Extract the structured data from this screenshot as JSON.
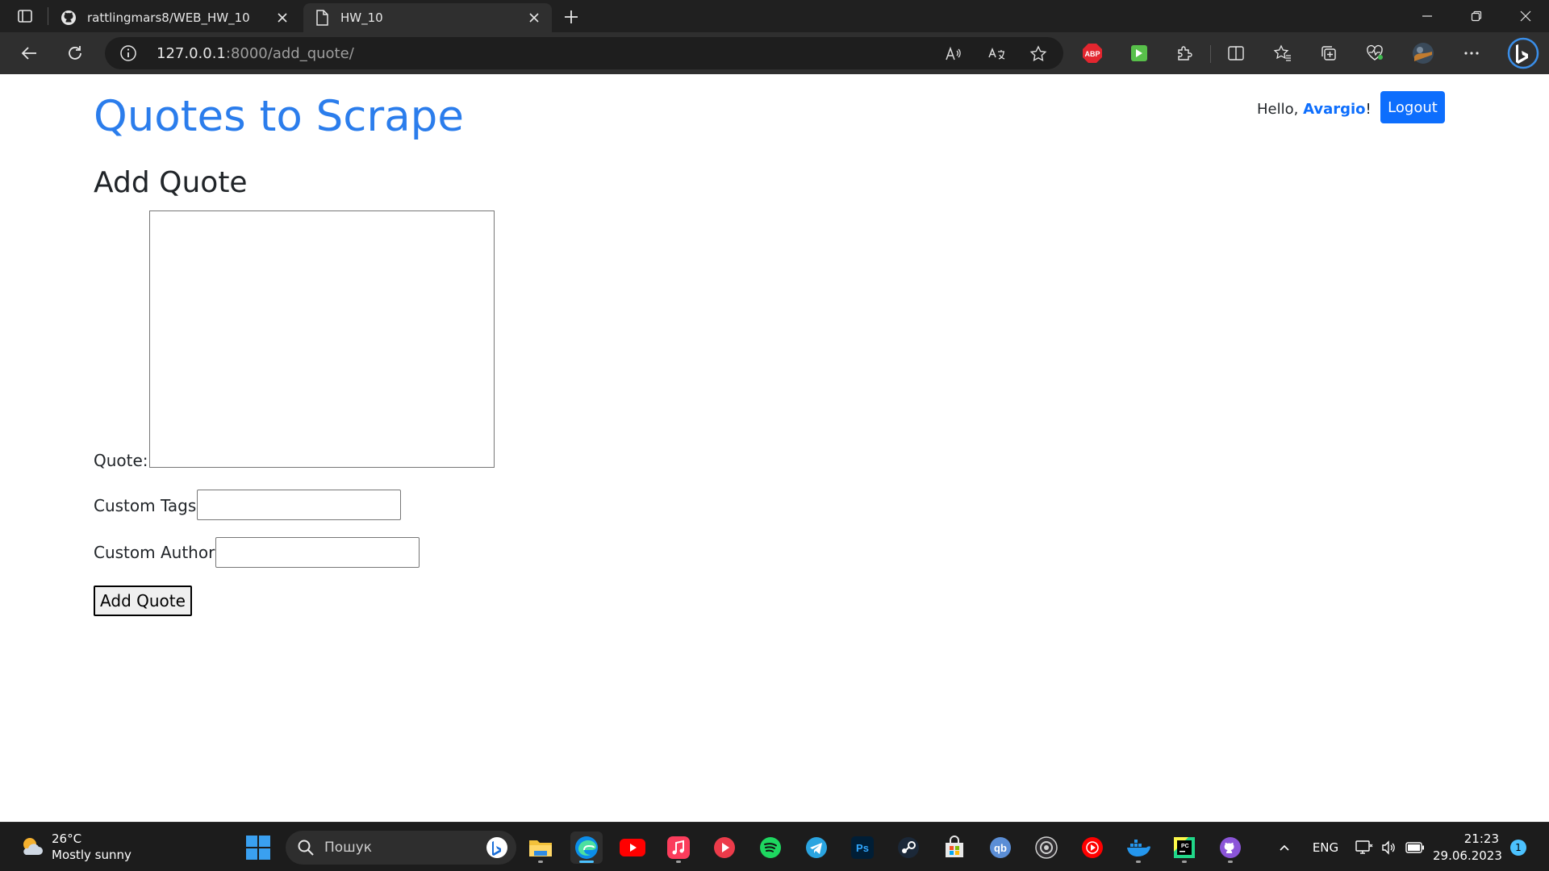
{
  "browser": {
    "tabs": [
      {
        "title": "rattlingmars8/WEB_HW_10",
        "icon": "github-icon",
        "active": false
      },
      {
        "title": "HW_10",
        "icon": "page-icon",
        "active": true
      }
    ],
    "url_host": "127.0.0.1",
    "url_path": ":8000/add_quote/",
    "extensions": {
      "abp_label": "ABP"
    }
  },
  "site": {
    "title": "Quotes to Scrape",
    "greeting_prefix": "Hello, ",
    "username": "Avargio",
    "greeting_suffix": "!",
    "logout_label": "Logout"
  },
  "form": {
    "heading": "Add Quote",
    "quote_label": "Quote:",
    "quote_value": "",
    "tags_label": "Custom Tags:",
    "tags_value": "",
    "author_label": "Custom Author:",
    "author_value": "",
    "submit_label": "Add Quote"
  },
  "taskbar": {
    "weather_temp": "26°C",
    "weather_desc": "Mostly sunny",
    "search_placeholder": "Пошук",
    "language": "ENG",
    "time": "21:23",
    "date": "29.06.2023",
    "notification_count": "1",
    "colors": {
      "edge": "#0c8de8",
      "youtube": "#ff0000",
      "spotify": "#1ed760",
      "telegram": "#2aa4e0"
    }
  }
}
